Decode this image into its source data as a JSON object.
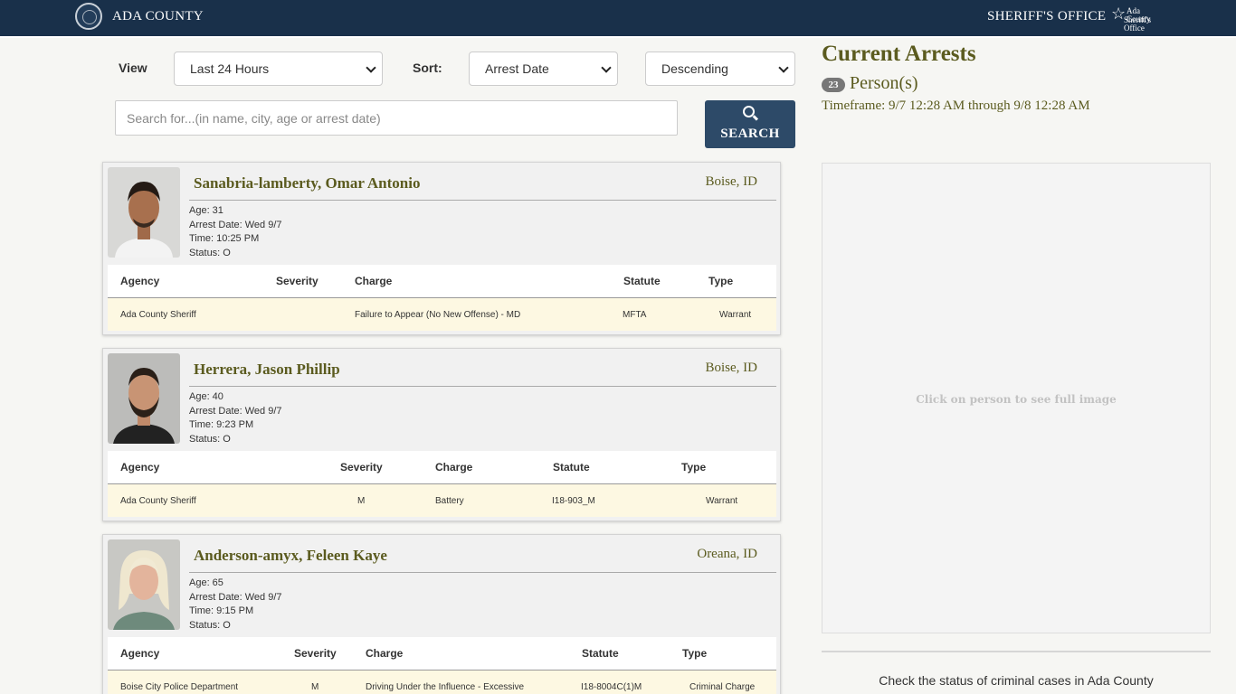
{
  "header": {
    "county": "ADA COUNTY",
    "office": "SHERIFF'S OFFICE",
    "logo_line1": "Ada County",
    "logo_line2": "Sheriff's Office"
  },
  "filters": {
    "view_label": "View",
    "view_value": "Last 24 Hours",
    "sort_label": "Sort:",
    "sort_value": "Arrest Date",
    "order_value": "Descending",
    "search_placeholder": "Search for...(in name, city, age or arrest date)",
    "search_button": "SEARCH"
  },
  "arrests": [
    {
      "name": "Sanabria-lamberty, Omar Antonio",
      "city": "Boise, ID",
      "age": "Age: 31",
      "arrest_date": "Arrest Date: Wed 9/7",
      "time": "Time: 10:25 PM",
      "status": "Status: O",
      "headers": {
        "agency": "Agency",
        "severity": "Severity",
        "charge": "Charge",
        "statute": "Statute",
        "type": "Type"
      },
      "row": {
        "agency": "Ada County Sheriff",
        "severity": "",
        "charge": "Failure to Appear (No New Offense) - MD",
        "statute": "MFTA",
        "type": "Warrant"
      }
    },
    {
      "name": "Herrera, Jason Phillip",
      "city": "Boise, ID",
      "age": "Age: 40",
      "arrest_date": "Arrest Date: Wed 9/7",
      "time": "Time: 9:23 PM",
      "status": "Status: O",
      "headers": {
        "agency": "Agency",
        "severity": "Severity",
        "charge": "Charge",
        "statute": "Statute",
        "type": "Type"
      },
      "row": {
        "agency": "Ada County Sheriff",
        "severity": "M",
        "charge": "Battery",
        "statute": "I18-903_M",
        "type": "Warrant"
      }
    },
    {
      "name": "Anderson-amyx, Feleen Kaye",
      "city": "Oreana, ID",
      "age": "Age: 65",
      "arrest_date": "Arrest Date: Wed 9/7",
      "time": "Time: 9:15 PM",
      "status": "Status: O",
      "headers": {
        "agency": "Agency",
        "severity": "Severity",
        "charge": "Charge",
        "statute": "Statute",
        "type": "Type"
      },
      "row": {
        "agency": "Boise City Police Department",
        "severity": "M",
        "charge": "Driving Under the Influence - Excessive",
        "statute": "I18-8004C(1)M",
        "type": "Criminal Charge"
      }
    }
  ],
  "summary": {
    "title": "Current Arrests",
    "count": "23",
    "count_label": "Person(s)",
    "timeframe": "Timeframe: 9/7 12:28 AM through 9/8 12:28 AM",
    "image_hint": "Click on person to see full image",
    "cases_link": "Check the status of criminal cases in Ada County"
  },
  "colors": {
    "header_bg": "#19304a",
    "accent_olive": "#5b5b1f",
    "button_bg": "#2d4a68",
    "charge_row_bg": "#fdf8e2"
  }
}
